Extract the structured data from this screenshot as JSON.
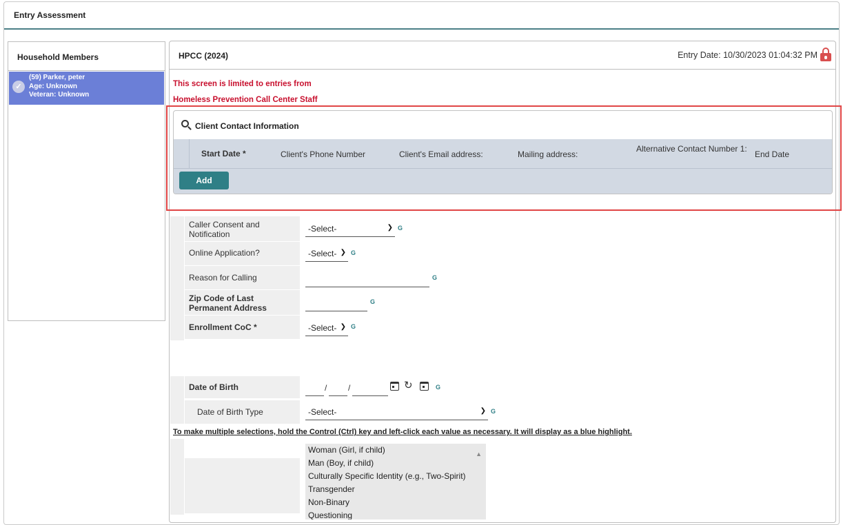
{
  "header": {
    "title": "Entry Assessment"
  },
  "household": {
    "title": "Household Members",
    "member": {
      "name": "(59) Parker, peter",
      "age": "Age: Unknown",
      "veteran": "Veteran: Unknown"
    }
  },
  "assessment": {
    "title": "HPCC (2024)",
    "entry_date": "Entry Date: 10/30/2023 01:04:32 PM",
    "warning_line1": "This screen is limited to entries from",
    "warning_line2": "Homeless Prevention Call Center Staff"
  },
  "contact_info": {
    "title": "Client Contact Information",
    "columns": [
      "Start Date *",
      "Client's Phone Number",
      "Client's Email address:",
      "Mailing address:",
      "Alternative Contact Number 1:",
      "End Date"
    ],
    "add_label": "Add"
  },
  "form": {
    "caller_consent": {
      "label": "Caller Consent and Notification",
      "value": "-Select-"
    },
    "online_application": {
      "label": "Online Application?",
      "value": "-Select-"
    },
    "reason_for_calling": {
      "label": "Reason for Calling",
      "value": ""
    },
    "zip_code": {
      "label": "Zip Code of Last Permanent Address",
      "value": ""
    },
    "enrollment_coc": {
      "label": "Enrollment CoC *",
      "value": "-Select-"
    },
    "date_of_birth": {
      "label": "Date of Birth"
    },
    "date_of_birth_type": {
      "label": "Date of Birth Type",
      "value": "-Select-"
    },
    "g_label": "G"
  },
  "multi_select_instructions": "To make multiple selections, hold the Control (Ctrl) key and left-click each value as necessary. It will display as a blue highlight.",
  "gender_options": [
    "Woman (Girl, if child)",
    "Man (Boy, if child)",
    "Culturally Specific Identity (e.g., Two-Spirit)",
    "Transgender",
    "Non-Binary",
    "Questioning"
  ],
  "colors": {
    "accent": "#2f7f86",
    "warning": "#c8102e",
    "highlight_border": "#e04444",
    "selected_member": "#6b7fd7"
  }
}
